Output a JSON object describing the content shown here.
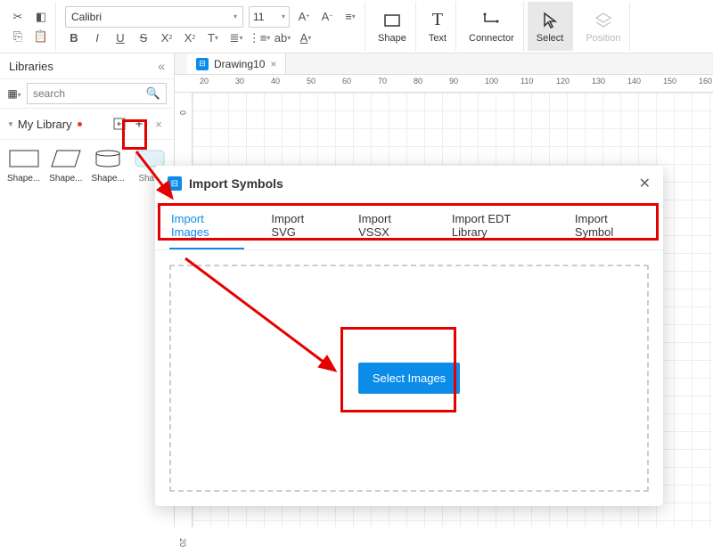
{
  "toolbar": {
    "font": "Calibri",
    "size": "11",
    "shape": "Shape",
    "text": "Text",
    "connector": "Connector",
    "select": "Select",
    "position": "Position"
  },
  "sidebar": {
    "title": "Libraries",
    "search_placeholder": "search",
    "library_name": "My Library",
    "shapes": [
      {
        "label": "Shape..."
      },
      {
        "label": "Shape..."
      },
      {
        "label": "Shape..."
      },
      {
        "label": "Sha..."
      }
    ]
  },
  "tabs": {
    "doc1": "Drawing10"
  },
  "ruler_h": [
    "20",
    "30",
    "40",
    "50",
    "60",
    "70",
    "80",
    "90",
    "100",
    "110",
    "120",
    "130",
    "140",
    "150",
    "160"
  ],
  "ruler_v": [
    "0",
    "20"
  ],
  "modal": {
    "title": "Import Symbols",
    "tabs": [
      {
        "label": "Import Images",
        "active": true
      },
      {
        "label": "Import SVG"
      },
      {
        "label": "Import VSSX"
      },
      {
        "label": "Import EDT Library"
      },
      {
        "label": "Import Symbol"
      }
    ],
    "select_btn": "Select Images"
  }
}
